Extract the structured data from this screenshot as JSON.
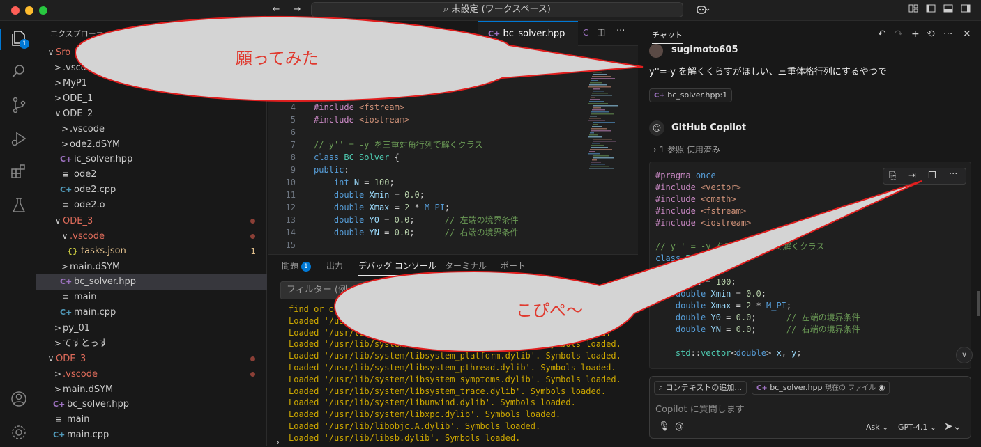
{
  "titlebar": {
    "search": "未設定 (ワークスペース)",
    "nav_back": "←",
    "nav_fwd": "→"
  },
  "activity": {
    "explorer_badge": "1"
  },
  "explorer": {
    "header": "エクスプローラー",
    "rows": [
      {
        "chev": "∨",
        "label": "Sro",
        "indent": 0,
        "color": "#e06c5b"
      },
      {
        "chev": ">",
        "label": ".vscode",
        "indent": 1
      },
      {
        "chev": ">",
        "label": "MyP1",
        "indent": 1
      },
      {
        "chev": ">",
        "label": "ODE_1",
        "indent": 1
      },
      {
        "chev": "∨",
        "label": "ODE_2",
        "indent": 1
      },
      {
        "chev": ">",
        "label": ".vscode",
        "indent": 2
      },
      {
        "chev": ">",
        "label": "ode2.dSYM",
        "indent": 2
      },
      {
        "icon": "C+",
        "iconColor": "#a074c4",
        "label": "ic_solver.hpp",
        "indent": 2
      },
      {
        "icon": "≡",
        "iconColor": "#cccccc",
        "label": "ode2",
        "indent": 2
      },
      {
        "icon": "C+",
        "iconColor": "#519aba",
        "label": "ode2.cpp",
        "indent": 2
      },
      {
        "icon": "≡",
        "iconColor": "#cccccc",
        "label": "ode2.o",
        "indent": 2
      },
      {
        "chev": "∨",
        "label": "ODE_3",
        "indent": 1,
        "color": "#e06c5b",
        "dot": true
      },
      {
        "chev": "∨",
        "label": ".vscode",
        "indent": 2,
        "color": "#e06c5b",
        "dot": true
      },
      {
        "icon": "{}",
        "iconColor": "#cbcb41",
        "label": "tasks.json",
        "indent": 3,
        "color": "#e2c08d",
        "count": "1"
      },
      {
        "chev": ">",
        "label": "main.dSYM",
        "indent": 2
      },
      {
        "icon": "C+",
        "iconColor": "#a074c4",
        "label": "bc_solver.hpp",
        "indent": 2,
        "selected": true
      },
      {
        "icon": "≡",
        "iconColor": "#cccccc",
        "label": "main",
        "indent": 2
      },
      {
        "icon": "C+",
        "iconColor": "#519aba",
        "label": "main.cpp",
        "indent": 2
      },
      {
        "chev": ">",
        "label": "py_01",
        "indent": 1
      },
      {
        "chev": ">",
        "label": "てすとっす",
        "indent": 1
      },
      {
        "chev": "∨",
        "label": "ODE_3",
        "indent": 0,
        "color": "#e06c5b",
        "dot": true
      },
      {
        "chev": ">",
        "label": ".vscode",
        "indent": 1,
        "color": "#e06c5b",
        "dot": true
      },
      {
        "chev": ">",
        "label": "main.dSYM",
        "indent": 1
      },
      {
        "icon": "C+",
        "iconColor": "#a074c4",
        "label": "bc_solver.hpp",
        "indent": 1
      },
      {
        "icon": "≡",
        "iconColor": "#cccccc",
        "label": "main",
        "indent": 1
      },
      {
        "icon": "C+",
        "iconColor": "#519aba",
        "label": "main.cpp",
        "indent": 1
      }
    ]
  },
  "editor": {
    "active_tab": "bc_solver.hpp",
    "lines": [
      {
        "n": "4",
        "html": "<span class=\"pp\">#include</span> <span class=\"str\">&lt;fstream&gt;</span>"
      },
      {
        "n": "5",
        "html": "<span class=\"pp\">#include</span> <span class=\"str\">&lt;iostream&gt;</span>"
      },
      {
        "n": "6",
        "html": ""
      },
      {
        "n": "7",
        "html": "<span class=\"cm\">// y'' = -y を三重対角行列で解くクラス</span>"
      },
      {
        "n": "8",
        "html": "<span class=\"kw\">class</span> <span class=\"ty\">BC_Solver</span> {"
      },
      {
        "n": "9",
        "html": "<span class=\"kw\">public</span>:"
      },
      {
        "n": "10",
        "html": "    <span class=\"kw\">int</span> <span class=\"var\">N</span> = <span class=\"num\">100</span>;"
      },
      {
        "n": "11",
        "html": "    <span class=\"kw\">double</span> <span class=\"var\">Xmin</span> = <span class=\"num\">0.0</span>;"
      },
      {
        "n": "12",
        "html": "    <span class=\"kw\">double</span> <span class=\"var\">Xmax</span> = <span class=\"num\">2</span> * <span class=\"mac\">M_PI</span>;"
      },
      {
        "n": "13",
        "html": "    <span class=\"kw\">double</span> <span class=\"var\">Y0</span> = <span class=\"num\">0.0</span>;      <span class=\"cm\">// 左端の境界条件</span>"
      },
      {
        "n": "14",
        "html": "    <span class=\"kw\">double</span> <span class=\"var\">YN</span> = <span class=\"num\">0.0</span>;      <span class=\"cm\">// 右端の境界条件</span>"
      },
      {
        "n": "15",
        "html": ""
      }
    ]
  },
  "panel": {
    "tabs": [
      "問題",
      "出力",
      "デバッグ コンソール",
      "ターミナル",
      "ポート"
    ],
    "problems_badge": "1",
    "filter_placeholder": "フィルター (例: テキスト、!除外、\\エスケープ)",
    "output_lines": [
      "find or op",
      "Loaded '/usr/lib/system/libsystem_networkextension.dylib'.",
      "Loaded '/usr/lib/system/libsystem_notify.dylib'. Symbols loaded.",
      "Loaded '/usr/lib/system/libsystem_platform.dylib'. Symbols loaded.",
      "Loaded '/usr/lib/system/libsystem_platform.dylib'. Symbols loaded.",
      "Loaded '/usr/lib/system/libsystem_pthread.dylib'. Symbols loaded.",
      "Loaded '/usr/lib/system/libsystem_symptoms.dylib'. Symbols loaded.",
      "Loaded '/usr/lib/system/libsystem_trace.dylib'. Symbols loaded.",
      "Loaded '/usr/lib/system/libunwind.dylib'. Symbols loaded.",
      "Loaded '/usr/lib/system/libxpc.dylib'. Symbols loaded.",
      "Loaded '/usr/lib/libobjc.A.dylib'. Symbols loaded.",
      "Loaded '/usr/lib/libsb.dylib'. Symbols loaded."
    ]
  },
  "chat": {
    "title": "チャット",
    "user_name": "sugimoto605",
    "user_message": "y''=-y を解くくらすがほしい、三重体格行列にするやつで",
    "user_ref": "bc_solver.hpp:1",
    "assistant_name": "GitHub Copilot",
    "refs_line": "1 参照 使用済み",
    "code_lines": [
      {
        "html": "<span class=\"pp\">#pragma</span> <span class=\"kw\">once</span>"
      },
      {
        "html": "<span class=\"pp\">#include</span> <span class=\"str\">&lt;vector&gt;</span>"
      },
      {
        "html": "<span class=\"pp\">#include</span> <span class=\"str\">&lt;cmath&gt;</span>"
      },
      {
        "html": "<span class=\"pp\">#include</span> <span class=\"str\">&lt;fstream&gt;</span>"
      },
      {
        "html": "<span class=\"pp\">#include</span> <span class=\"str\">&lt;iostream&gt;</span>"
      },
      {
        "html": ""
      },
      {
        "html": "<span class=\"cm\">// y'' = -y を三重対角行列で解くクラス</span>"
      },
      {
        "html": "<span class=\"kw\">class</span> <span class=\"ty\">BC_Solver</span> {"
      },
      {
        "html": "<span class=\"kw\">public</span>:"
      },
      {
        "html": "    <span class=\"kw\">int</span> <span class=\"var\">N</span> = <span class=\"num\">100</span>;"
      },
      {
        "html": "    <span class=\"kw\">double</span> <span class=\"var\">Xmin</span> = <span class=\"num\">0.0</span>;"
      },
      {
        "html": "    <span class=\"kw\">double</span> <span class=\"var\">Xmax</span> = <span class=\"num\">2</span> * <span class=\"mac\">M_PI</span>;"
      },
      {
        "html": "    <span class=\"kw\">double</span> <span class=\"var\">Y0</span> = <span class=\"num\">0.0</span>;      <span class=\"cm\">// 左端の境界条件</span>"
      },
      {
        "html": "    <span class=\"kw\">double</span> <span class=\"var\">YN</span> = <span class=\"num\">0.0</span>;      <span class=\"cm\">// 右端の境界条件</span>"
      },
      {
        "html": ""
      },
      {
        "html": "    <span class=\"ty\">std</span>::<span class=\"ty\">vector</span>&lt;<span class=\"kw\">double</span>&gt; <span class=\"var\">x</span>, <span class=\"var\">y</span>;"
      }
    ],
    "add_context": "コンテキストの追加...",
    "context_file": "bc_solver.hpp",
    "context_file_note": "現在の ファイル",
    "input_placeholder": "Copilot に質問します",
    "mode": "Ask",
    "model": "GPT-4.1"
  },
  "annotations": {
    "bubble1": "願ってみた",
    "bubble2": "こぴぺ〜"
  }
}
